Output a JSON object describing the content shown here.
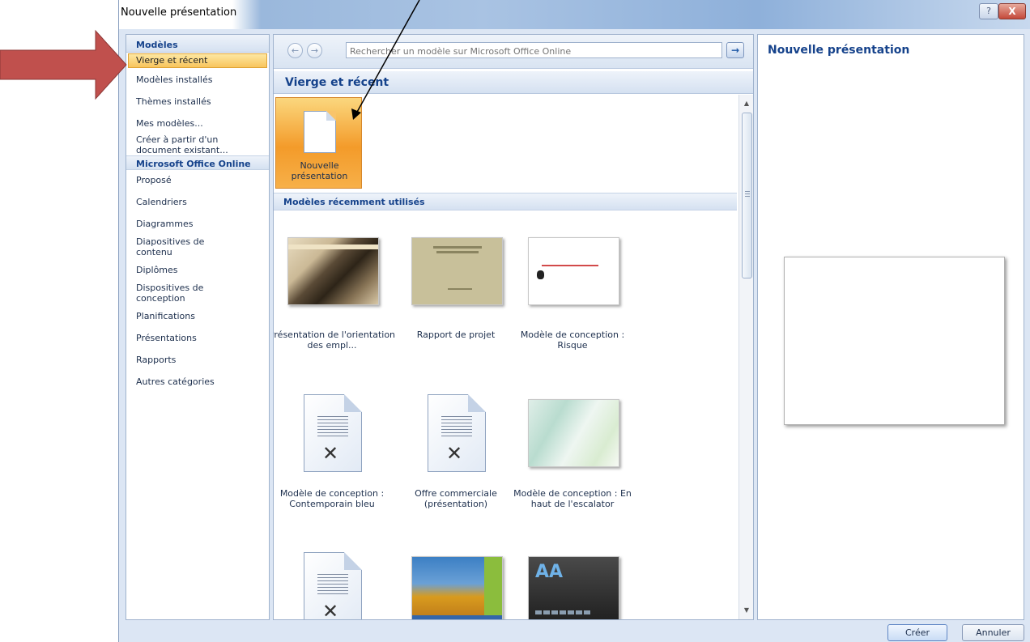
{
  "window": {
    "title": "Nouvelle présentation",
    "help_glyph": "?",
    "close_glyph": "X"
  },
  "sidebar": {
    "header": "Modèles",
    "items": [
      {
        "label": "Vierge et récent",
        "selected": true
      },
      {
        "label": "Modèles installés"
      },
      {
        "label": "Thèmes installés"
      },
      {
        "label": "Mes modèles..."
      },
      {
        "label": "Créer à partir d'un document existant..."
      }
    ],
    "online_header": "Microsoft Office Online",
    "online_items": [
      {
        "label": "Proposé"
      },
      {
        "label": "Calendriers"
      },
      {
        "label": "Diagrammes"
      },
      {
        "label": "Diapositives de contenu"
      },
      {
        "label": "Diplômes"
      },
      {
        "label": "Dispositives de conception"
      },
      {
        "label": "Planifications"
      },
      {
        "label": "Présentations"
      },
      {
        "label": "Rapports"
      },
      {
        "label": "Autres catégories"
      }
    ]
  },
  "search": {
    "back_glyph": "←",
    "forward_glyph": "→",
    "placeholder": "Rechercher un modèle sur Microsoft Office Online",
    "go_glyph": "→"
  },
  "main": {
    "heading": "Vierge et récent",
    "blank_label": "Nouvelle présentation",
    "recent_header": "Modèles récemment utilisés",
    "templates": [
      {
        "label": "Présentation de l'orientation des empl...",
        "thumb": "photo"
      },
      {
        "label": "Rapport de projet",
        "thumb": "olive"
      },
      {
        "label": "Modèle de conception : Risque",
        "thumb": "risk"
      },
      {
        "label": "Modèle de conception : Contemporain bleu",
        "thumb": "document"
      },
      {
        "label": "Offre commerciale (présentation)",
        "thumb": "document"
      },
      {
        "label": "Modèle de conception : En haut de l'escalator",
        "thumb": "escalator"
      },
      {
        "label": "",
        "thumb": "document"
      },
      {
        "label": "",
        "thumb": "sunflower"
      },
      {
        "label": "",
        "thumb": "dark"
      }
    ],
    "thumb_texts": {
      "olive_title": "Rapport sur le projet [Nom du projet]",
      "dark_letters": "AA"
    }
  },
  "preview": {
    "title": "Nouvelle présentation"
  },
  "buttons": {
    "create": "Créer",
    "cancel": "Annuler"
  },
  "colors": {
    "accent": "#15428b",
    "selected": "#f8c55d",
    "annotation_arrow": "#c0504d"
  },
  "icons": [
    "back-icon",
    "forward-icon",
    "go-icon",
    "help-icon",
    "close-icon",
    "blank-document-icon",
    "scroll-up-icon",
    "scroll-down-icon"
  ]
}
